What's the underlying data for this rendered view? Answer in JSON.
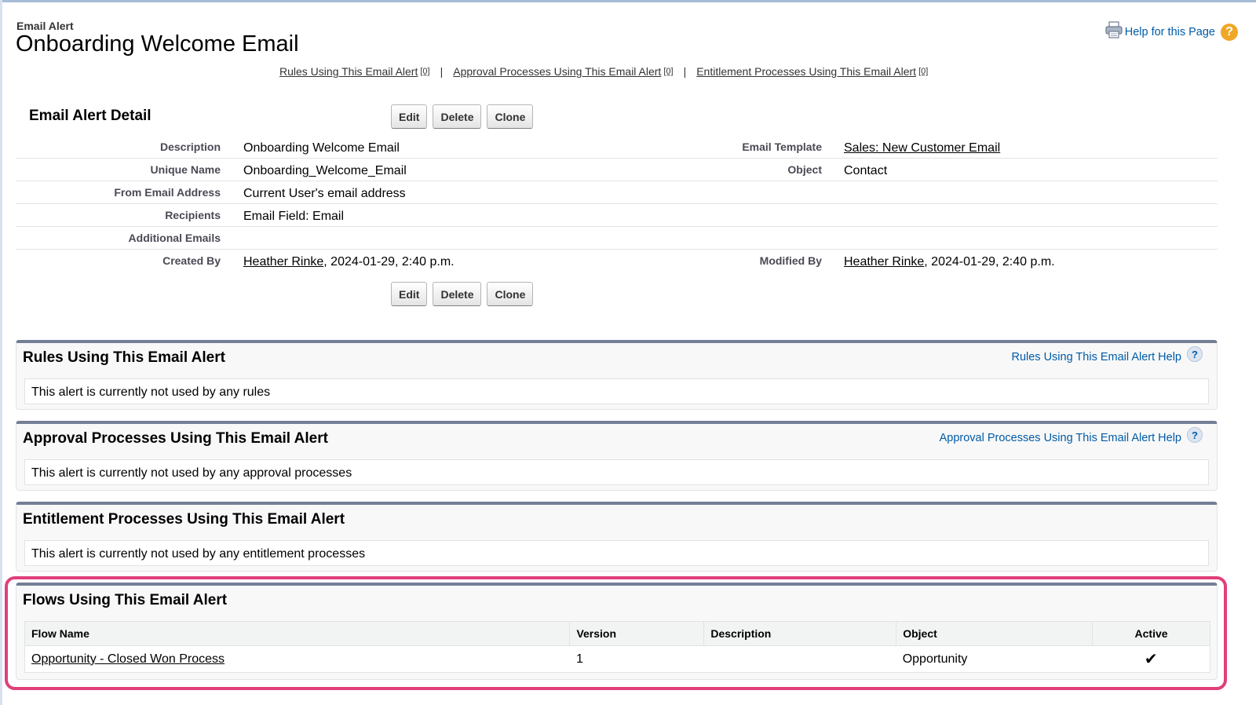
{
  "header": {
    "type_label": "Email Alert",
    "title": "Onboarding Welcome Email",
    "help_link": "Help for this Page"
  },
  "related_links": [
    {
      "label": "Rules Using This Email Alert",
      "count": "[0]"
    },
    {
      "label": "Approval Processes Using This Email Alert",
      "count": "[0]"
    },
    {
      "label": "Entitlement Processes Using This Email Alert",
      "count": "[0]"
    }
  ],
  "related_sep": "|",
  "detail": {
    "title": "Email Alert Detail",
    "buttons": {
      "edit": "Edit",
      "delete": "Delete",
      "clone": "Clone"
    },
    "rows": [
      {
        "label1": "Description",
        "value1": "Onboarding Welcome Email",
        "label2": "Email Template",
        "value2": "Sales: New Customer Email"
      },
      {
        "label1": "Unique Name",
        "value1": "Onboarding_Welcome_Email",
        "label2": "Object",
        "value2": "Contact"
      },
      {
        "label1": "From Email Address",
        "value1": "Current User's email address"
      },
      {
        "label1": "Recipients",
        "value1": "Email Field: Email"
      },
      {
        "label1": "Additional Emails",
        "value1": ""
      },
      {
        "label1": "Created By",
        "value1_link": "Heather Rinke",
        "value1_rest": ", 2024-01-29, 2:40 p.m.",
        "label2": "Modified By",
        "value2_link": "Heather Rinke",
        "value2_rest": ", 2024-01-29, 2:40 p.m."
      }
    ]
  },
  "rules_panel": {
    "title": "Rules Using This Email Alert",
    "help": "Rules Using This Email Alert Help",
    "message": "This alert is currently not used by any rules"
  },
  "approval_panel": {
    "title": "Approval Processes Using This Email Alert",
    "help": "Approval Processes Using This Email Alert Help",
    "message": "This alert is currently not used by any approval processes"
  },
  "entitlement_panel": {
    "title": "Entitlement Processes Using This Email Alert",
    "message": "This alert is currently not used by any entitlement processes"
  },
  "flows_panel": {
    "title": "Flows Using This Email Alert",
    "columns": [
      "Flow Name",
      "Version",
      "Description",
      "Object",
      "Active"
    ],
    "rows": [
      {
        "flow_name": "Opportunity - Closed Won Process",
        "version": "1",
        "description": "",
        "object": "Opportunity",
        "active": "✔"
      }
    ]
  },
  "colors": {
    "accent_link": "#015ba7",
    "highlight": "#e0407a",
    "panel_border": "#747e96"
  }
}
